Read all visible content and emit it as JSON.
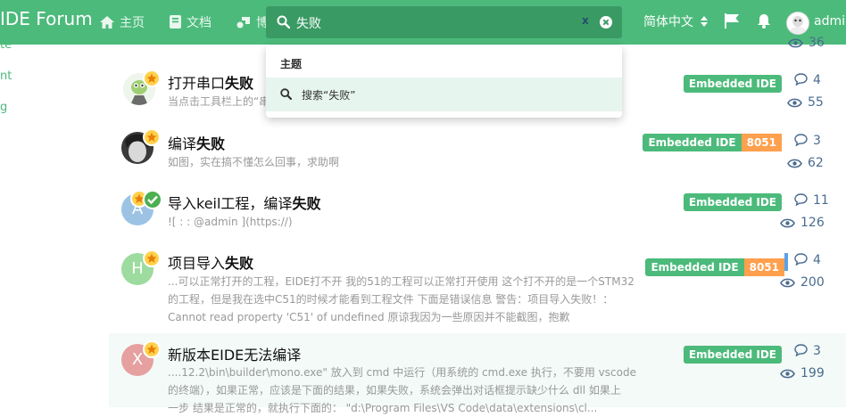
{
  "header": {
    "brand": "IDE Forum",
    "nav": {
      "home": "主页",
      "docs": "文档",
      "third": "博"
    },
    "search": {
      "query": "失败",
      "x_label": "x"
    },
    "language": "简体中文",
    "user": "admin"
  },
  "sidebar": {
    "items": [
      "te",
      "nt",
      "g"
    ]
  },
  "dropdown": {
    "section": "主题",
    "item": "搜索“失败”"
  },
  "top_stat": "36",
  "discussions": [
    {
      "title_prefix": "打开串口",
      "title_em": "失败",
      "title_suffix": "",
      "excerpt": "当点击工具栏上的“串",
      "tags": [
        "Embedded IDE"
      ],
      "replies": "4",
      "views": "55",
      "avatar_letter": ""
    },
    {
      "title_prefix": "编译",
      "title_em": "失败",
      "title_suffix": "",
      "excerpt": "如图，实在搞不懂怎么回事，求助啊",
      "tags": [
        "Embedded IDE",
        "8051"
      ],
      "replies": "3",
      "views": "62",
      "avatar_letter": ""
    },
    {
      "title_prefix": "导入keil工程，编译",
      "title_em": "失败",
      "title_suffix": "",
      "excerpt": "![ : : @admin ](https://)",
      "tags": [
        "Embedded IDE"
      ],
      "replies": "11",
      "views": "126",
      "avatar_letter": "A"
    },
    {
      "title_prefix": "项目导入",
      "title_em": "失败",
      "title_suffix": "",
      "excerpt_lines": [
        "...可以正常打开的工程，EIDE打不开 我的51的工程可以正常打开使用 这个打不开的是一个STM32",
        "的工程，但是我在选中C51的时候才能看到工程文件 下面是错误信息 警告：项目导入失败！：",
        "Cannot read property 'C51' of undefined 原谅我因为一些原因并不能截图，抱歉"
      ],
      "tags": [
        "Embedded IDE",
        "8051"
      ],
      "replies": "4",
      "views": "200",
      "avatar_letter": "H"
    },
    {
      "title_prefix": "新版本EIDE无法编译",
      "title_em": "",
      "title_suffix": "",
      "excerpt_lines": [
        "....12.2\\bin\\builder\\mono.exe\" 放入到 cmd 中运行（用系统的 cmd.exe 执行，不要用 vscode",
        "的终端），如果正常，应该是下面的结果，如果失败，系统会弹出对话框提示缺少什么 dll 如果上",
        "一步 结果是正常的，就执行下面的： \"d:\\Program Files\\VS Code\\data\\extensions\\cl..."
      ],
      "tags": [
        "Embedded IDE"
      ],
      "replies": "3",
      "views": "199",
      "avatar_letter": "X"
    }
  ],
  "colors": {
    "primary": "#4cba7b",
    "tag_orange": "#ffa04e",
    "avatar_blue": "#9cc3e4",
    "avatar_green": "#9ddb9f",
    "avatar_red": "#e6a0a0"
  }
}
